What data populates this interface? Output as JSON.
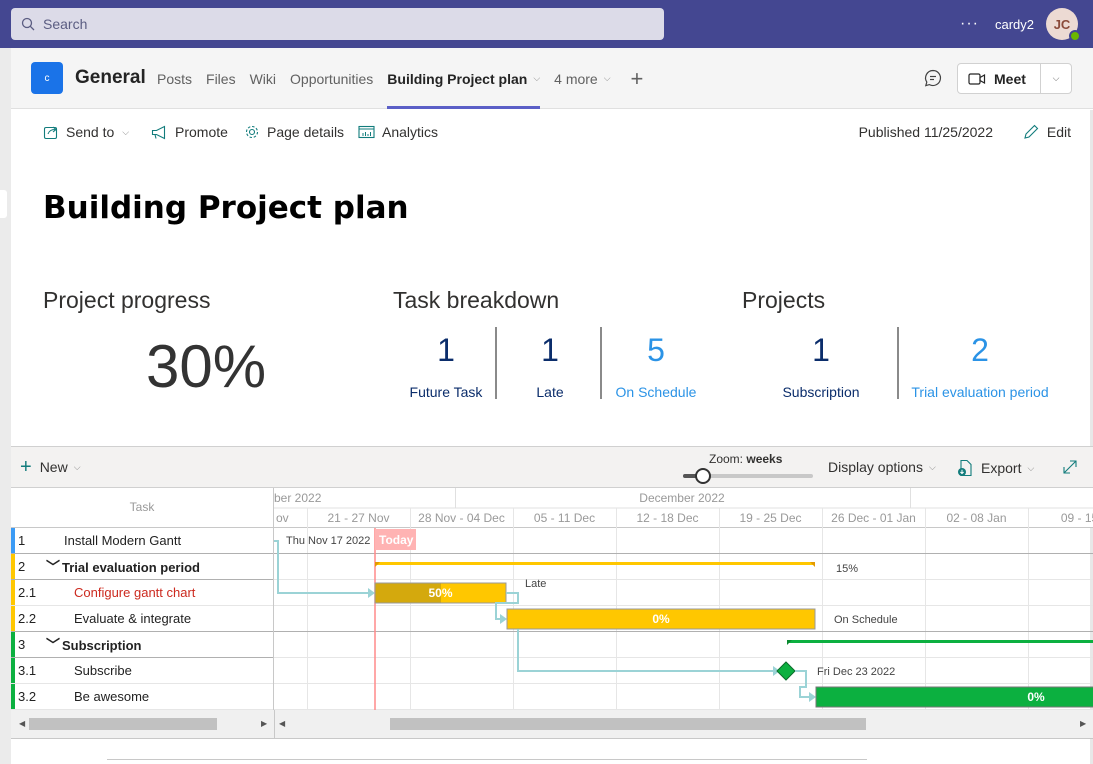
{
  "topbar": {
    "search_placeholder": "Search",
    "more_label": "···",
    "username": "cardy2",
    "avatar_initials": "JC",
    "presence": "available"
  },
  "channel": {
    "logo_letter": "c",
    "name": "General",
    "tabs": [
      {
        "label": "Posts",
        "active": false
      },
      {
        "label": "Files",
        "active": false
      },
      {
        "label": "Wiki",
        "active": false
      },
      {
        "label": "Opportunities",
        "active": false
      },
      {
        "label": "Building Project plan",
        "active": true
      },
      {
        "label": "4 more",
        "active": false
      }
    ],
    "add_tab_label": "+",
    "meet_label": "Meet"
  },
  "commandbar": {
    "send_to": "Send to",
    "promote": "Promote",
    "page_details": "Page details",
    "analytics": "Analytics",
    "published": "Published 11/25/2022",
    "edit": "Edit"
  },
  "page": {
    "title": "Building Project plan",
    "progress": {
      "heading": "Project progress",
      "value": "30%"
    },
    "task_breakdown": {
      "heading": "Task breakdown",
      "items": [
        {
          "value": "1",
          "label": "Future Task",
          "tone": "dark"
        },
        {
          "value": "1",
          "label": "Late",
          "tone": "dark"
        },
        {
          "value": "5",
          "label": "On Schedule",
          "tone": "light"
        }
      ]
    },
    "projects": {
      "heading": "Projects",
      "items": [
        {
          "value": "1",
          "label": "Subscription",
          "tone": "dark"
        },
        {
          "value": "2",
          "label": "Trial evaluation period",
          "tone": "light"
        }
      ]
    }
  },
  "gantt": {
    "toolbar": {
      "new_label": "New",
      "zoom_label": "Zoom:",
      "zoom_value": "weeks",
      "zoom_slider_fraction": 0.15,
      "display_options": "Display options",
      "export": "Export"
    },
    "task_header": "Task",
    "months": [
      {
        "label": "ber 2022"
      },
      {
        "label": "December 2022"
      }
    ],
    "weeks": [
      "ov",
      "21 - 27 Nov",
      "28 Nov - 04 Dec",
      "05 - 11 Dec",
      "12 - 18 Dec",
      "19 - 25 Dec",
      "26 Dec - 01 Jan",
      "02 - 08 Jan",
      "09 - 15"
    ],
    "today_label": "Today",
    "colors": {
      "blue": "#3b9bf5",
      "yellow": "#ffc700",
      "yellow_dark": "#d4a90d",
      "green": "#0cb040",
      "link": "#9bd3d6",
      "today": "#ff8a8a",
      "late_text": "#cc2a1f"
    },
    "rows": [
      {
        "wbs": "1",
        "name": "Install Modern Gantt",
        "group": false,
        "color": "#3b9bf5",
        "late": false,
        "bar_label": "",
        "side_label": "Thu Nov 17 2022"
      },
      {
        "wbs": "2",
        "name": "Trial evaluation period",
        "group": true,
        "color": "#ffc700",
        "late": false,
        "bar_label": "",
        "side_label": "15%"
      },
      {
        "wbs": "2.1",
        "name": "Configure gantt chart",
        "group": false,
        "color": "#ffc700",
        "late": true,
        "bar_label": "50%",
        "progress": 0.5,
        "side_label": "Late"
      },
      {
        "wbs": "2.2",
        "name": "Evaluate & integrate",
        "group": false,
        "color": "#ffc700",
        "late": false,
        "bar_label": "0%",
        "progress": 0,
        "side_label": "On Schedule"
      },
      {
        "wbs": "3",
        "name": "Subscription",
        "group": true,
        "color": "#0cb040",
        "late": false,
        "bar_label": "",
        "side_label": ""
      },
      {
        "wbs": "3.1",
        "name": "Subscribe",
        "group": false,
        "color": "#0cb040",
        "late": false,
        "bar_label": "",
        "side_label": "Fri Dec 23 2022",
        "milestone": true
      },
      {
        "wbs": "3.2",
        "name": "Be awesome",
        "group": false,
        "color": "#0cb040",
        "late": false,
        "bar_label": "0%",
        "progress": 0,
        "side_label": ""
      }
    ]
  }
}
